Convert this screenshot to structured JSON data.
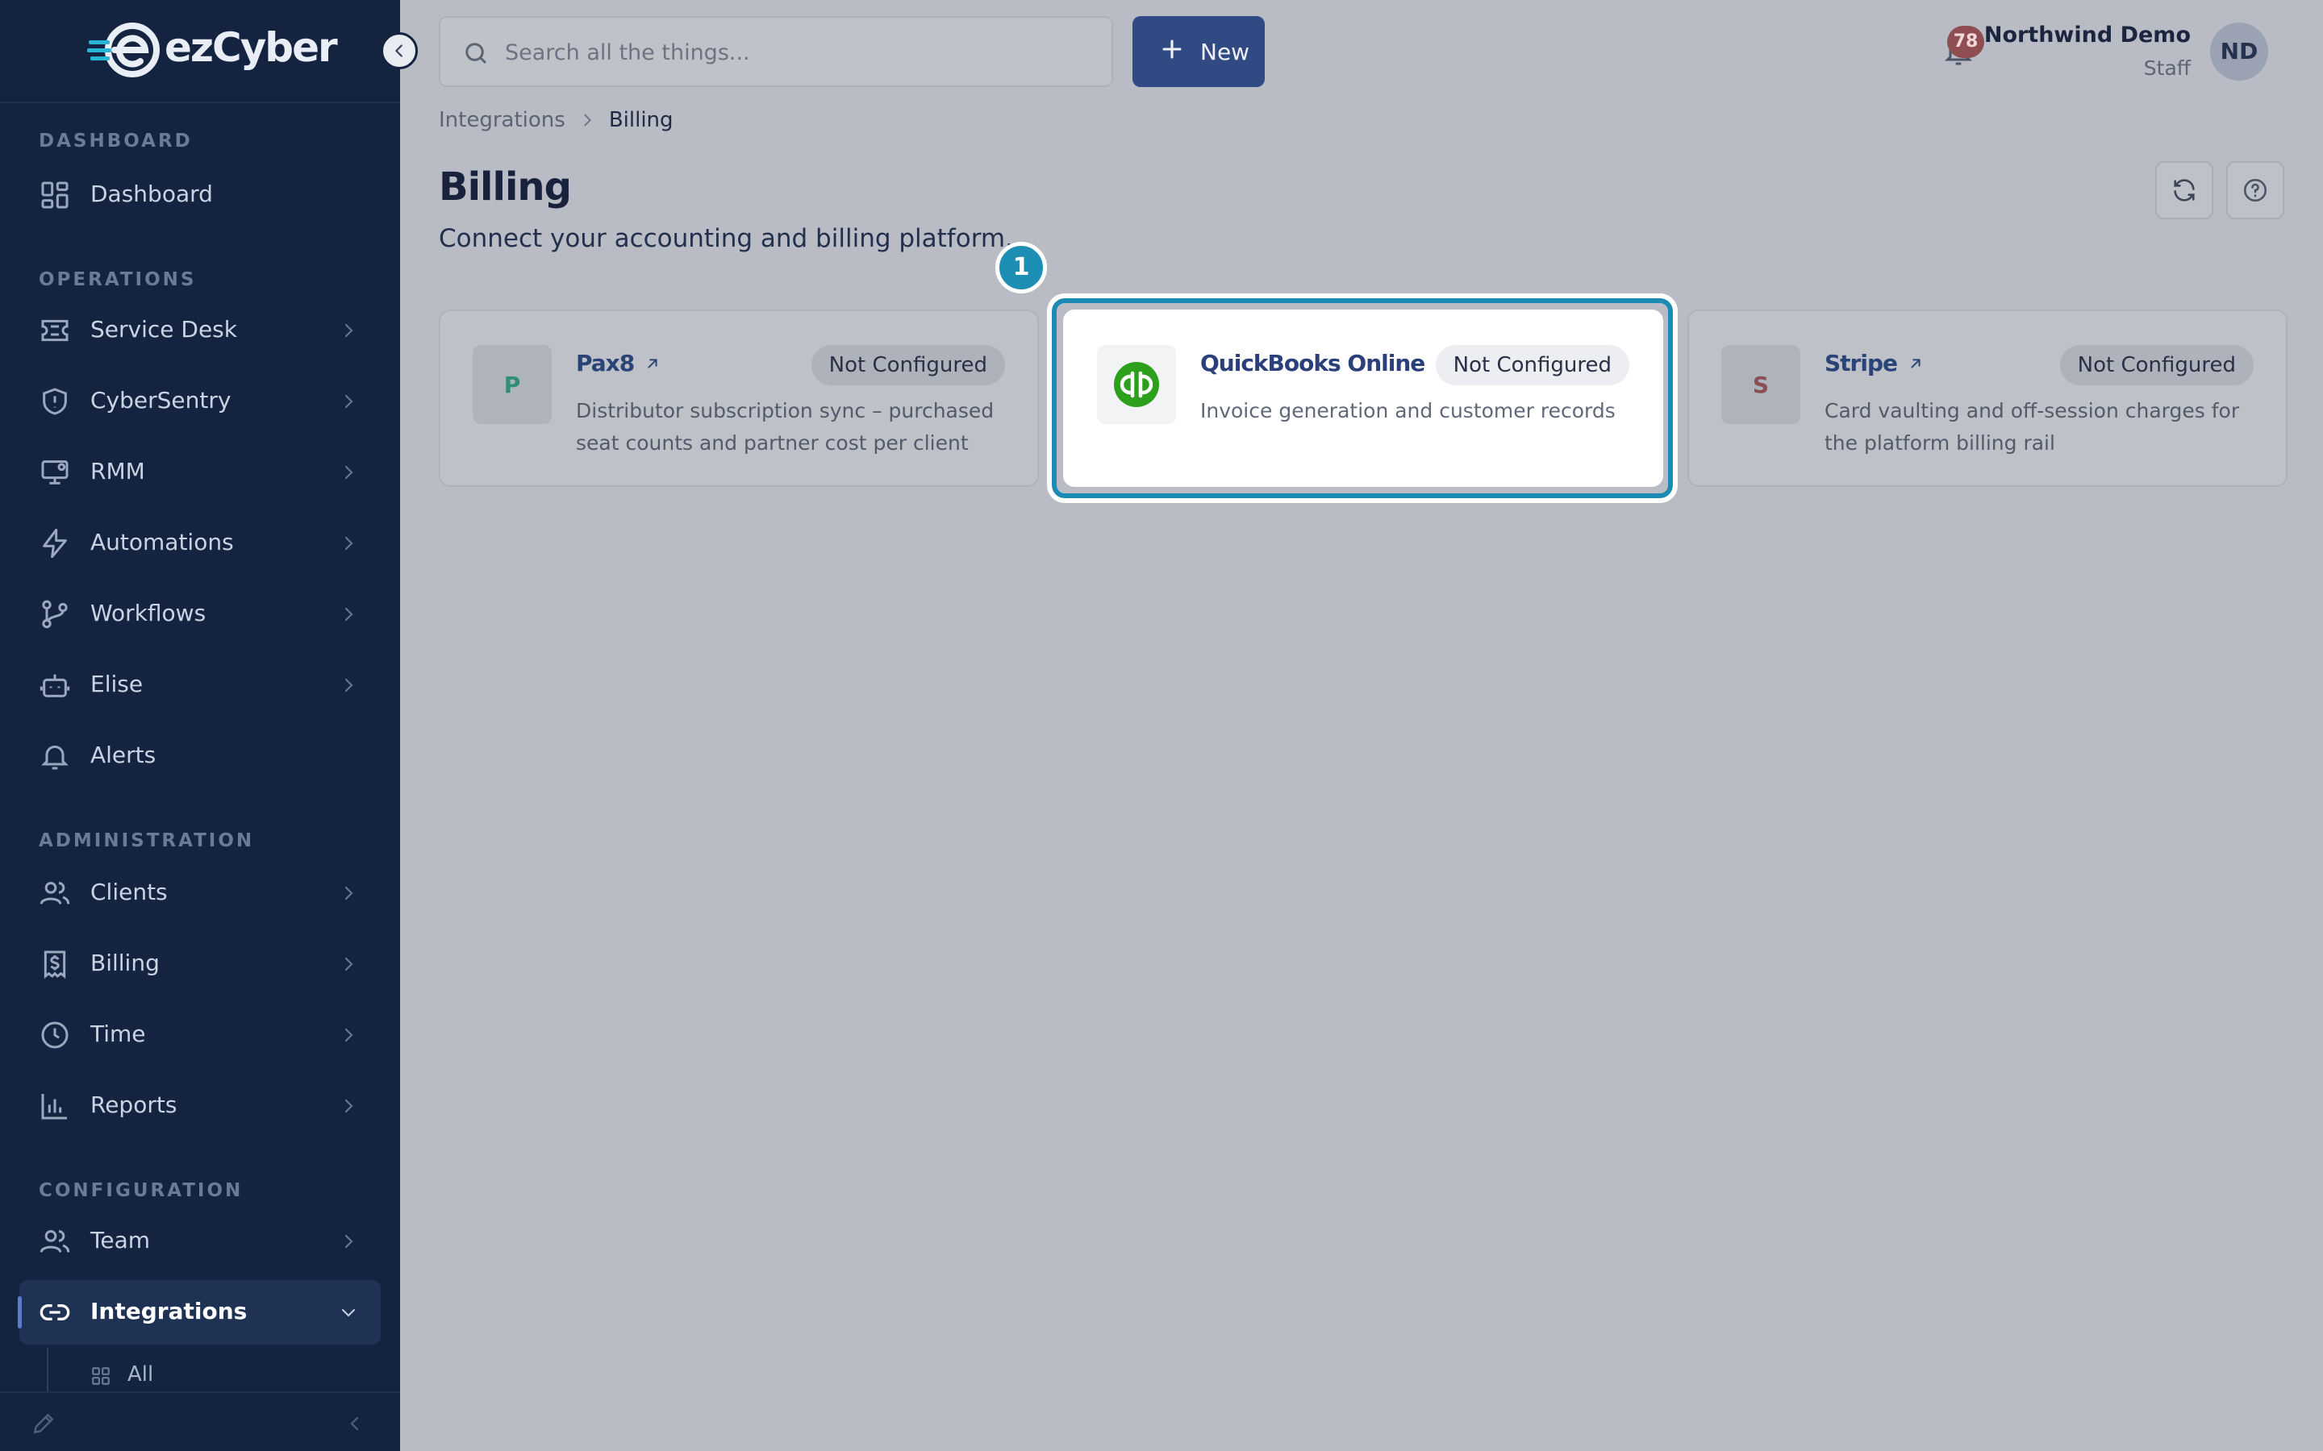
{
  "brand": {
    "name": "ezCyber",
    "logo_letter": "e"
  },
  "sidebar": {
    "sections": [
      {
        "label": "DASHBOARD"
      },
      {
        "label": "OPERATIONS"
      },
      {
        "label": "ADMINISTRATION"
      },
      {
        "label": "CONFIGURATION"
      }
    ],
    "items": [
      {
        "label": "Dashboard",
        "icon": "dashboard-grid-icon"
      },
      {
        "label": "Service Desk",
        "icon": "ticket-icon"
      },
      {
        "label": "CyberSentry",
        "icon": "shield-icon"
      },
      {
        "label": "RMM",
        "icon": "monitor-icon"
      },
      {
        "label": "Automations",
        "icon": "lightning-icon"
      },
      {
        "label": "Workflows",
        "icon": "git-branch-icon"
      },
      {
        "label": "Elise",
        "icon": "bot-icon"
      },
      {
        "label": "Alerts",
        "icon": "bell-icon"
      },
      {
        "label": "Clients",
        "icon": "users-icon"
      },
      {
        "label": "Billing",
        "icon": "receipt-dollar-icon"
      },
      {
        "label": "Time",
        "icon": "clock-icon"
      },
      {
        "label": "Reports",
        "icon": "bar-chart-icon"
      },
      {
        "label": "Team",
        "icon": "team-icon"
      },
      {
        "label": "Integrations",
        "icon": "link-icon"
      }
    ],
    "sub_items": [
      {
        "label": "All",
        "icon": "grid-small-icon"
      }
    ]
  },
  "topbar": {
    "search_placeholder": "Search all the things...",
    "new_label": "New",
    "notification_count": "78",
    "user_name": "Northwind Demo",
    "user_role": "Staff",
    "avatar_initials": "ND"
  },
  "breadcrumb": {
    "parent": "Integrations",
    "current": "Billing"
  },
  "page": {
    "title": "Billing",
    "subtitle": "Connect your accounting and billing platform."
  },
  "step_marker": "1",
  "cards": [
    {
      "name": "Pax8",
      "tile_letter": "P",
      "status": "Not Configured",
      "description": "Distributor subscription sync – purchased seat counts and partner cost per client",
      "tile_color": "#2f8f7a"
    },
    {
      "name": "QuickBooks Online",
      "tile_letter": "qb",
      "status": "Not Configured",
      "description": "Invoice generation and customer records",
      "tile_color": "#2ca01c"
    },
    {
      "name": "Stripe",
      "tile_letter": "S",
      "status": "Not Configured",
      "description": "Card vaulting and off-session charges for the platform billing rail",
      "tile_color": "#8a4f55"
    }
  ],
  "colors": {
    "sidebar_bg": "#142440",
    "accent": "#324a83",
    "focus": "#1c8bb4"
  }
}
